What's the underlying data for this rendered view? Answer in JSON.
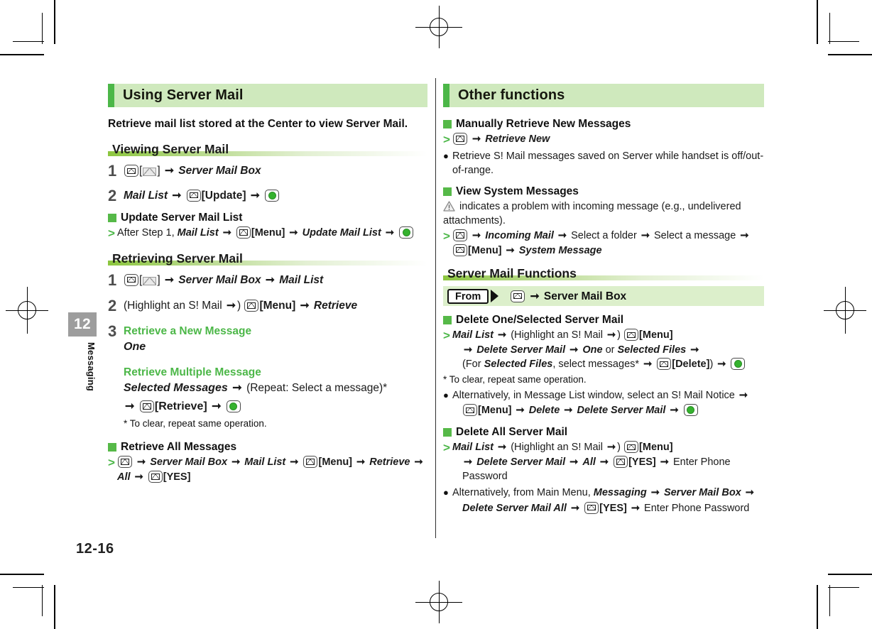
{
  "page": {
    "folio": "12-16",
    "chapter_number": "12",
    "chapter_name": "Messaging"
  },
  "left_column": {
    "banner_title": "Using Server Mail",
    "lead": "Retrieve mail list stored at the Center to view Server Mail.",
    "sections": [
      {
        "subhead": "Viewing Server Mail",
        "steps": [
          {
            "n": "1",
            "text_parts": [
              "[MAIL-KEY]",
              "[",
              "[ENVELOPE]",
              "]",
              " → ",
              "Server Mail Box"
            ]
          },
          {
            "n": "2",
            "text_parts": [
              "Mail List",
              " → ",
              "[MAIL-KEY]",
              "[Update]",
              " → ",
              "[CENTER-KEY]"
            ]
          }
        ],
        "green_heading": "Update Server Mail List",
        "op_line": "After Step 1, Mail List → [MAIL-KEY][Menu] → Update Mail List → [CENTER-KEY]"
      },
      {
        "subhead": "Retrieving Server Mail",
        "step1": "[MAIL-KEY][[ENVELOPE]] → Server Mail Box → Mail List",
        "step2": "(Highlight an S! Mail → ) [MAIL-KEY][Menu] → Retrieve",
        "step3": {
          "number": "3",
          "option_a_title": "Retrieve a New Message",
          "option_a_value": "One",
          "option_b_title": "Retrieve Multiple Message",
          "option_b_value": "Selected Messages → (Repeat: Select a message)*",
          "option_b_line2": "→ [MAIL-KEY][Retrieve] → [CENTER-KEY]",
          "footnote": "* To clear, repeat same operation."
        },
        "green_heading": "Retrieve All Messages",
        "op_line": "[MAIL-KEY] → Server Mail Box → Mail List → [MAIL-KEY][Menu] → Retrieve → All → [MAIL-KEY][YES]"
      }
    ]
  },
  "right_column": {
    "banner_title": "Other functions",
    "items": [
      {
        "green_heading": "Manually Retrieve New Messages",
        "op_line": "[MAIL-KEY] → Retrieve New",
        "bullet": "Retrieve S! Mail messages saved on Server while handset is off/out-of-range."
      },
      {
        "green_heading": "View System Messages",
        "note": "[WARN-ICON] indicates a problem with incoming message (e.g., undelivered attachments).",
        "op_line_1": "[MAIL-KEY] → Incoming Mail → Select a folder → Select a message →",
        "op_line_2": "[MAIL-KEY][Menu] → System Message"
      }
    ],
    "subhead": "Server Mail Functions",
    "from_label": "From",
    "from_value": "[MAIL-KEY] → Server Mail Box",
    "functions": [
      {
        "green_heading": "Delete One/Selected Server Mail",
        "lines": [
          "Mail List → (Highlight an S! Mail → ) [MAIL-KEY][Menu]",
          "→ Delete Server Mail → One or Selected Files →",
          "(For Selected Files, select messages* → [MAIL-KEY][Delete]) → [CENTER-KEY]"
        ],
        "footnote": "* To clear, repeat same operation.",
        "bullet_line1": "Alternatively, in Message List window, select an S! Mail Notice →",
        "bullet_line2": "[MAIL-KEY][Menu] → Delete → Delete Server Mail → [CENTER-KEY]"
      },
      {
        "green_heading": "Delete All Server Mail",
        "lines": [
          "Mail List → (Highlight an S! Mail → ) [MAIL-KEY][Menu]",
          "→ Delete Server Mail → All → [MAIL-KEY][YES] → Enter Phone Password"
        ],
        "bullet_line1": "Alternatively, from Main Menu, Messaging → Server Mail Box →",
        "bullet_line2": "Delete Server Mail All → [MAIL-KEY][YES] → Enter Phone Password"
      }
    ]
  },
  "labels": {
    "update": "[Update]",
    "menu": "[Menu]",
    "retrieve": "[Retrieve]",
    "delete": "[Delete]",
    "yes": "[YES]"
  },
  "colors": {
    "banner_bg": "#cfe9bd",
    "banner_accent": "#4cb748",
    "green_text": "#4cb748",
    "green_square": "#56b948",
    "tab_gray": "#9d9d9d",
    "from_band": "#dcefcb"
  }
}
